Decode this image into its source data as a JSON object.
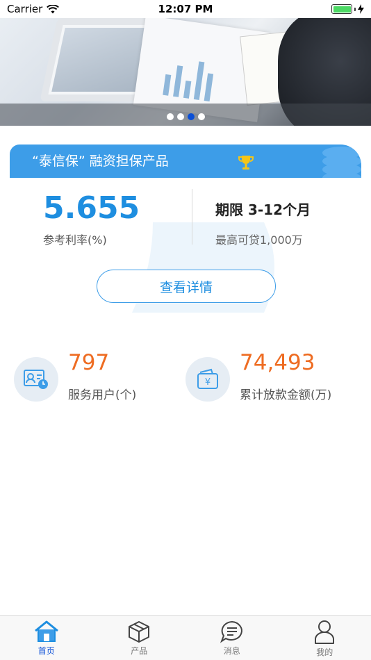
{
  "status_bar": {
    "carrier": "Carrier",
    "time": "12:07 PM"
  },
  "banner": {
    "slide_count": 4,
    "active_slide": 3
  },
  "product": {
    "title": "“泰信保” 融资担保产品",
    "rate_value": "5.655",
    "rate_label": "参考利率(%)",
    "term": "期限 3-12个月",
    "max_loan": "最高可贷1,000万",
    "detail_button": "查看详情"
  },
  "metrics": [
    {
      "icon": "id-card-clock-icon",
      "value": "797",
      "label": "服务用户(个)"
    },
    {
      "icon": "wallet-yen-icon",
      "value": "74,493",
      "label": "累计放款金额(万)"
    }
  ],
  "tabbar": {
    "active": "home",
    "items": [
      {
        "icon": "home-icon",
        "label": "首页"
      },
      {
        "icon": "box-icon",
        "label": "产品"
      },
      {
        "icon": "chat-icon",
        "label": "消息"
      },
      {
        "icon": "user-icon",
        "label": "我的"
      }
    ]
  },
  "colors": {
    "primary": "#3d9de8",
    "accent_orange": "#ee6c22",
    "active_tab": "#0b4fd6"
  }
}
